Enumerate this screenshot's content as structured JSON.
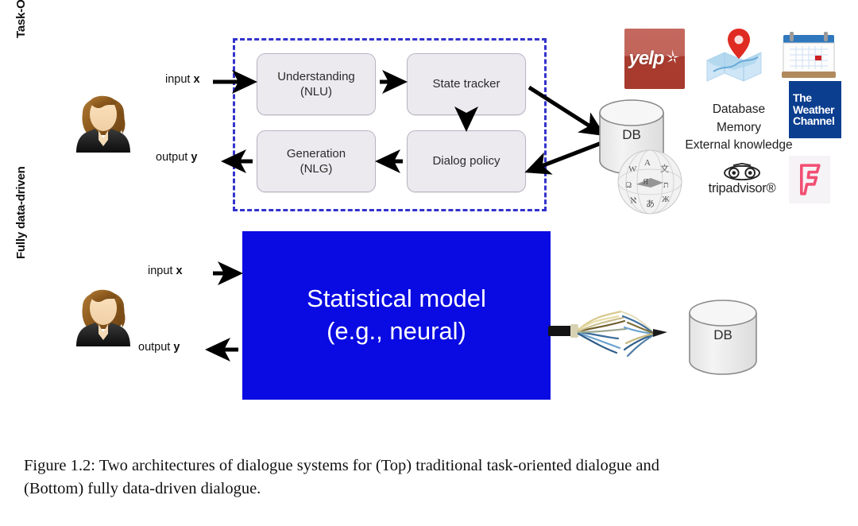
{
  "figure": {
    "rows": [
      {
        "label": "Task-Oriented Dialog"
      },
      {
        "label": "Fully data-driven"
      }
    ],
    "io": {
      "input_prefix": "input ",
      "input_var": "x",
      "output_prefix": "output ",
      "output_var": "y"
    },
    "pipeline_boxes": [
      {
        "name": "understanding",
        "line1": "Understanding",
        "line2": "(NLU)"
      },
      {
        "name": "state-tracker",
        "line1": "State tracker",
        "line2": ""
      },
      {
        "name": "generation",
        "line1": "Generation",
        "line2": "(NLG)"
      },
      {
        "name": "dialog-policy",
        "line1": "Dialog policy",
        "line2": ""
      }
    ],
    "blue_box": {
      "line1": "Statistical model",
      "line2": "(e.g., neural)",
      "color": "#0a0ae2",
      "text_color": "#ffffff"
    },
    "databases": [
      {
        "name": "db-top",
        "label": "DB"
      },
      {
        "name": "db-bottom",
        "label": "DB"
      }
    ],
    "knowledge_text": [
      "Database",
      "Memory",
      "External knowledge"
    ],
    "logos": [
      {
        "name": "yelp-logo",
        "label": "yelp",
        "color": "#a93c2f"
      },
      {
        "name": "maps-logo",
        "label": "",
        "color": "#9ecdf0"
      },
      {
        "name": "calendar-logo",
        "label": "",
        "color": "#3d7fc1"
      },
      {
        "name": "weather-channel-logo",
        "l1": "The",
        "l2": "Weather",
        "l3": "Channel",
        "color": "#0b3e8f"
      },
      {
        "name": "wikipedia-logo",
        "label": "",
        "color": "#d8d8d8"
      },
      {
        "name": "tripadvisor-logo",
        "label": "tripadvisor®",
        "color": "#222222"
      },
      {
        "name": "foursquare-logo",
        "label": "",
        "color": "#f24e72"
      }
    ],
    "dashed_border_color": "#3333cc"
  },
  "caption": {
    "line1": "Figure 1.2: Two architectures of dialogue systems for (Top) traditional task-oriented dialogue and",
    "line2": "(Bottom) fully data-driven dialogue."
  }
}
